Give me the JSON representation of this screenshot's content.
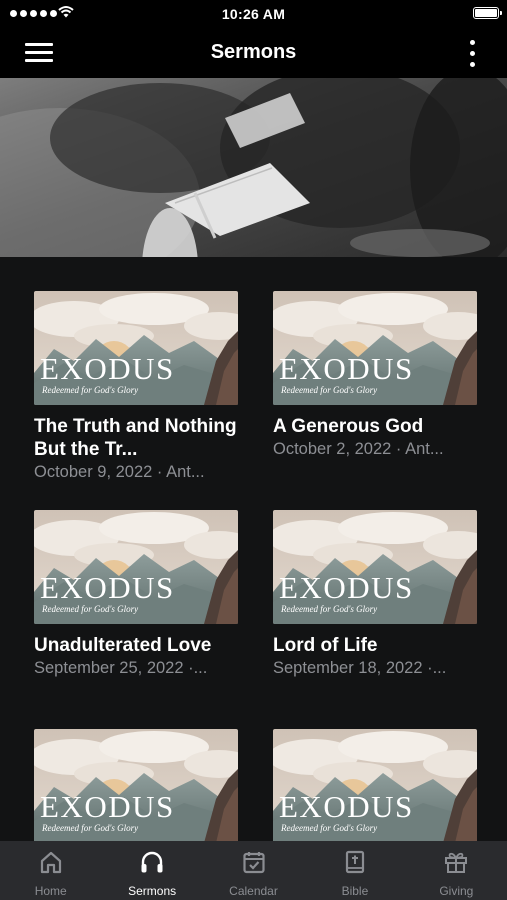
{
  "status_bar": {
    "time": "10:26 AM",
    "signal_icon": "signal-dots-icon",
    "wifi_icon": "wifi-icon",
    "battery_icon": "battery-icon"
  },
  "nav": {
    "title": "Sermons",
    "menu_icon": "hamburger-menu-icon",
    "more_icon": "more-vertical-icon"
  },
  "series": {
    "title": "EXODUS",
    "subtitle": "Redeemed for God's Glory"
  },
  "sermons": [
    {
      "title": "The Truth and Nothing But the Tr...",
      "meta": "October 9, 2022 · Ant..."
    },
    {
      "title": "A Generous God",
      "meta": "October 2, 2022 · Ant..."
    },
    {
      "title": "Unadulterated Love",
      "meta": "September 25, 2022 ·..."
    },
    {
      "title": "Lord of Life",
      "meta": "September 18, 2022 ·..."
    },
    {
      "title": "",
      "meta": ""
    },
    {
      "title": "",
      "meta": ""
    }
  ],
  "tabs": [
    {
      "label": "Home",
      "icon": "home-icon",
      "active": false
    },
    {
      "label": "Sermons",
      "icon": "headphones-icon",
      "active": true
    },
    {
      "label": "Calendar",
      "icon": "calendar-icon",
      "active": false
    },
    {
      "label": "Bible",
      "icon": "bible-icon",
      "active": false
    },
    {
      "label": "Giving",
      "icon": "gift-icon",
      "active": false
    }
  ],
  "colors": {
    "background": "#121314",
    "bars": "#000000",
    "tab_bar": "#2a2b2e",
    "tab_inactive": "#8b8d92",
    "meta_text": "#8d8f94"
  }
}
